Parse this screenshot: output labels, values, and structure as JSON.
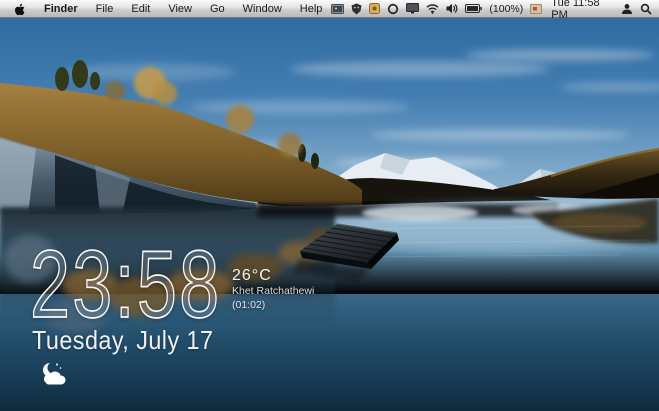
{
  "menu_bar": {
    "apple_icon": "apple-logo-icon",
    "menus": [
      "Finder",
      "File",
      "Edit",
      "View",
      "Go",
      "Window",
      "Help"
    ],
    "active_app": "Finder",
    "status_icons": [
      "screen-preview-icon",
      "shield-icon",
      "app-badge-icon",
      "sync-ring-icon",
      "display-icon",
      "wifi-icon",
      "volume-icon",
      "battery-icon",
      "input-source-flag-icon",
      "user-icon",
      "spotlight-search-icon"
    ],
    "status": {
      "battery_label": "(100%)",
      "clock": "Tue 11:58 PM"
    }
  },
  "lock_widget": {
    "time": "23:58",
    "date": "Tuesday, July 17",
    "weather": {
      "temperature": "26°C",
      "location": "Khet Ratchathewi",
      "secondary_time": "(01:02)",
      "condition_icon": "night-partly-cloudy-icon"
    }
  },
  "colors": {
    "menubar_text": "#1a1a1a",
    "widget_text": "#ffffff",
    "sky_top": "#2f6ba1",
    "water_deep": "#102a3d"
  }
}
